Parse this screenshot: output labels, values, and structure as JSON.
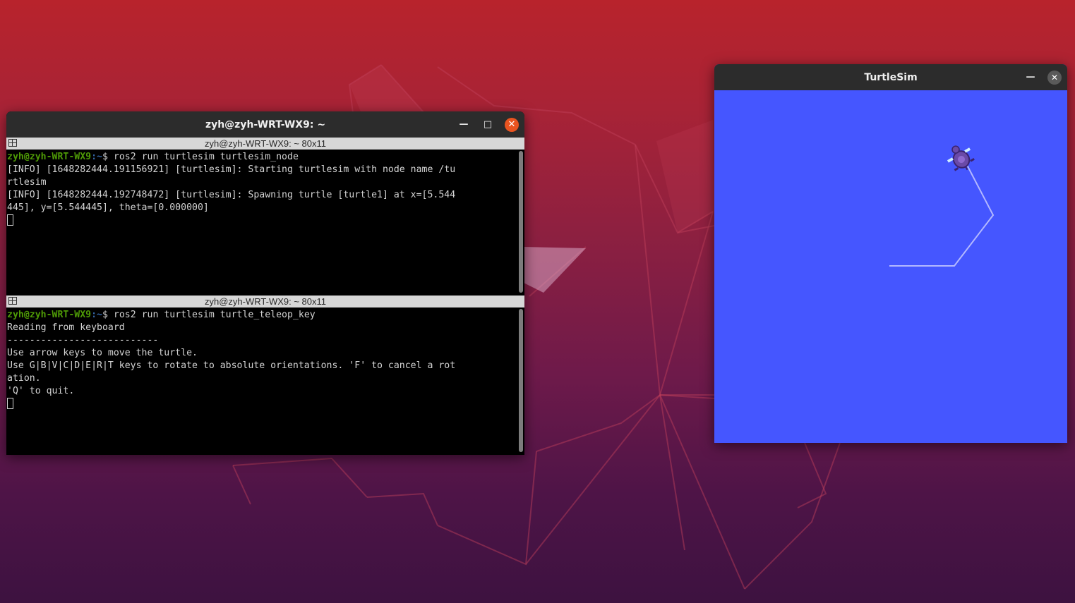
{
  "terminal": {
    "title": "zyh@zyh-WRT-WX9: ~",
    "minimize_icon": "minimize-icon",
    "maximize_icon": "maximize-icon",
    "close_icon": "close-icon",
    "panes": [
      {
        "header": "zyh@zyh-WRT-WX9: ~ 80x11",
        "prompt_user": "zyh@zyh-WRT-WX9",
        "prompt_path": ":~",
        "prompt_symbol": "$ ",
        "command": "ros2 run turtlesim turtlesim_node",
        "output": [
          "[INFO] [1648282444.191156921] [turtlesim]: Starting turtlesim with node name /tu",
          "rtlesim",
          "[INFO] [1648282444.192748472] [turtlesim]: Spawning turtle [turtle1] at x=[5.544",
          "445], y=[5.544445], theta=[0.000000]"
        ]
      },
      {
        "header": "zyh@zyh-WRT-WX9: ~ 80x11",
        "prompt_user": "zyh@zyh-WRT-WX9",
        "prompt_path": ":~",
        "prompt_symbol": "$ ",
        "command": "ros2 run turtlesim turtle_teleop_key",
        "output": [
          "Reading from keyboard",
          "---------------------------",
          "Use arrow keys to move the turtle.",
          "Use G|B|V|C|D|E|R|T keys to rotate to absolute orientations. 'F' to cancel a rot",
          "ation.",
          "'Q' to quit."
        ]
      }
    ]
  },
  "turtlesim": {
    "title": "TurtleSim",
    "minimize_icon": "minimize-icon",
    "close_icon": "close-icon",
    "background_color": "#4556ff",
    "pen_color": "#b3b8ff",
    "turtle_icon": "turtle-icon"
  },
  "colors": {
    "accent_close": "#e95420",
    "prompt_user": "#4e9a06",
    "prompt_path": "#3465a4",
    "terminal_text": "#d3d3d3"
  }
}
